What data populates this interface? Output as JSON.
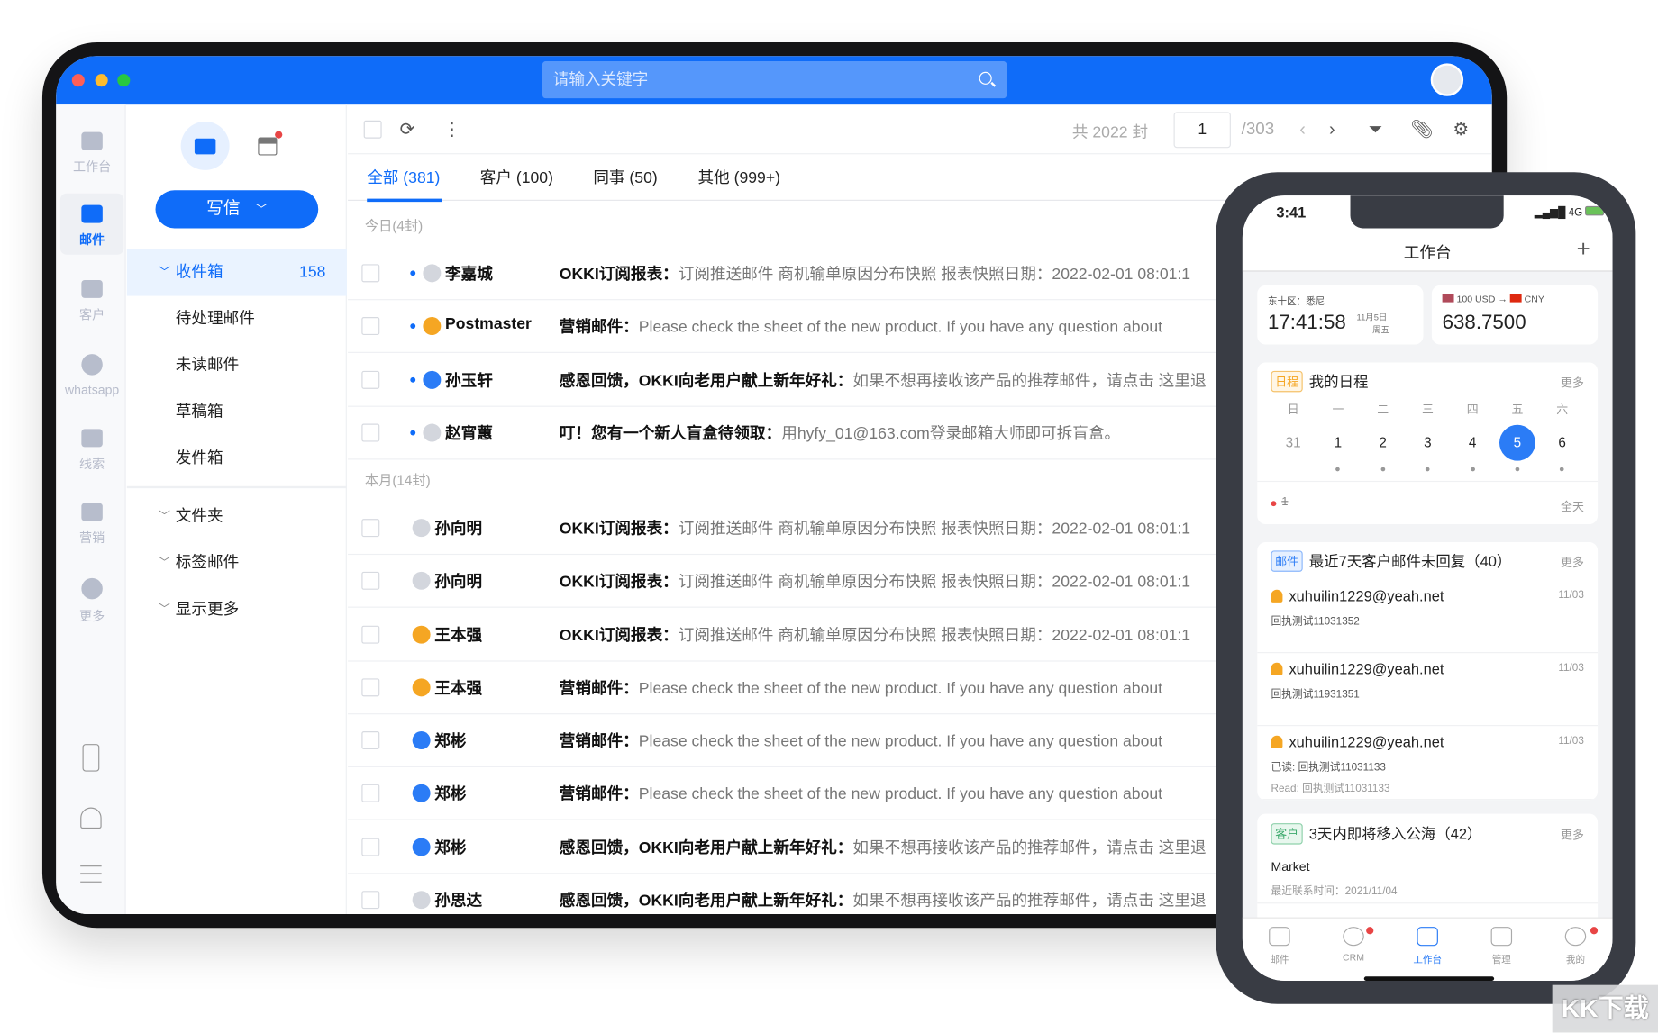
{
  "colors": {
    "brand": "#0f6cf9",
    "unread": "#0f6cf9",
    "badge": "#e84545"
  },
  "topbar": {
    "search_placeholder": "请输入关键字"
  },
  "rail": [
    {
      "label": "工作台",
      "icon": "desktop-icon"
    },
    {
      "label": "邮件",
      "icon": "mail-icon",
      "active": true
    },
    {
      "label": "客户",
      "icon": "users-icon"
    },
    {
      "label": "whatsapp",
      "icon": "whatsapp-icon"
    },
    {
      "label": "线索",
      "icon": "leads-icon"
    },
    {
      "label": "营销",
      "icon": "marketing-icon"
    },
    {
      "label": "更多",
      "icon": "more-icon"
    }
  ],
  "folders": {
    "compose": "写信",
    "inbox": {
      "label": "收件箱",
      "count": "158"
    },
    "sub": [
      "待处理邮件",
      "未读邮件",
      "草稿箱",
      "发件箱"
    ],
    "groups": [
      "文件夹",
      "标签邮件",
      "显示更多"
    ]
  },
  "toolbar": {
    "total": "共 2022 封",
    "page": "1",
    "pages": "/303"
  },
  "tabs": [
    "全部 (381)",
    "客户 (100)",
    "同事 (50)",
    "其他 (999+)"
  ],
  "sections": {
    "today": "今日(4封)",
    "month": "本月(14封)"
  },
  "mails": [
    {
      "name": "李嘉城",
      "unread": true,
      "avatar": "#d3d6dd",
      "title": "OKKI订阅报表：",
      "body": "订阅推送邮件 商机输单原因分布快照 报表快照日期：2022-02-01 08:01:1"
    },
    {
      "name": "Postmaster",
      "unread": true,
      "avatar": "#f5a623",
      "title": "营销邮件：",
      "body": "Please check the sheet of the new product. If you have any question about"
    },
    {
      "name": "孙玉轩",
      "unread": true,
      "avatar": "#2b7cf6",
      "title": "感恩回馈，OKKI向老用户献上新年好礼：",
      "body": "如果不想再接收该产品的推荐邮件，请点击 这里退"
    },
    {
      "name": "赵宵蕙",
      "unread": true,
      "avatar": "#d3d6dd",
      "title": "叮！您有一个新人盲盒待领取：",
      "body": "用hyfy_01@163.com登录邮箱大师即可拆盲盒。"
    },
    {
      "name": "孙向明",
      "unread": false,
      "avatar": "#d3d6dd",
      "title": "OKKI订阅报表：",
      "body": "订阅推送邮件 商机输单原因分布快照 报表快照日期：2022-02-01 08:01:1"
    },
    {
      "name": "孙向明",
      "unread": false,
      "avatar": "#d3d6dd",
      "title": "OKKI订阅报表：",
      "body": "订阅推送邮件 商机输单原因分布快照 报表快照日期：2022-02-01 08:01:1"
    },
    {
      "name": "王本强",
      "unread": false,
      "avatar": "#f5a623",
      "title": "OKKI订阅报表：",
      "body": "订阅推送邮件 商机输单原因分布快照 报表快照日期：2022-02-01 08:01:1"
    },
    {
      "name": "王本强",
      "unread": false,
      "avatar": "#f5a623",
      "title": "营销邮件：",
      "body": "Please check the sheet of the new product. If you have any question about"
    },
    {
      "name": "郑彬",
      "unread": false,
      "avatar": "#2b7cf6",
      "title": "营销邮件：",
      "body": "Please check the sheet of the new product. If you have any question about"
    },
    {
      "name": "郑彬",
      "unread": false,
      "avatar": "#2b7cf6",
      "title": "营销邮件：",
      "body": "Please check the sheet of the new product. If you have any question about"
    },
    {
      "name": "郑彬",
      "unread": false,
      "avatar": "#2b7cf6",
      "title": "感恩回馈，OKKI向老用户献上新年好礼：",
      "body": "如果不想再接收该产品的推荐邮件，请点击 这里退"
    },
    {
      "name": "孙思达",
      "unread": false,
      "avatar": "#d3d6dd",
      "title": "感恩回馈，OKKI向老用户献上新年好礼：",
      "body": "如果不想再接收该产品的推荐邮件，请点击 这里退"
    }
  ],
  "phone": {
    "time": "3:41",
    "network": "4G",
    "title": "工作台",
    "clock": {
      "zone": "东十区：悉尼",
      "time": "17:41:58",
      "date": "11月5日",
      "weekday": "周五"
    },
    "fx": {
      "from": "100 USD",
      "to": "CNY",
      "value": "638.7500"
    },
    "schedule": {
      "tag": "日程",
      "title": "我的日程",
      "more": "更多",
      "weekdays": [
        "日",
        "一",
        "二",
        "三",
        "四",
        "五",
        "六"
      ],
      "days": [
        "31",
        "1",
        "2",
        "3",
        "4",
        "5",
        "6"
      ],
      "selected_day": "5",
      "event": "1",
      "allday": "全天"
    },
    "mailcard": {
      "tag": "邮件",
      "title": "最近7天客户邮件未回复（40）",
      "more": "更多",
      "items": [
        {
          "from": "xuhuilin1229@yeah.net",
          "date": "11/03",
          "lines": [
            "回执测试11031352"
          ]
        },
        {
          "from": "xuhuilin1229@yeah.net",
          "date": "11/03",
          "lines": [
            "回执测试11931351"
          ]
        },
        {
          "from": "xuhuilin1229@yeah.net",
          "date": "11/03",
          "lines": [
            "已读: 回执测试11031133",
            "Read: 回执测试11031133"
          ]
        }
      ]
    },
    "custcard": {
      "tag": "客户",
      "title": "3天内即将移入公海（42）",
      "more": "更多",
      "company": "Market",
      "last_contact": "最近联系时间：2021/11/04"
    },
    "tabbar": [
      {
        "label": "邮件"
      },
      {
        "label": "CRM",
        "badge": true
      },
      {
        "label": "工作台",
        "active": true
      },
      {
        "label": "管理"
      },
      {
        "label": "我的",
        "badge": true
      }
    ]
  },
  "watermark": "KK下载"
}
